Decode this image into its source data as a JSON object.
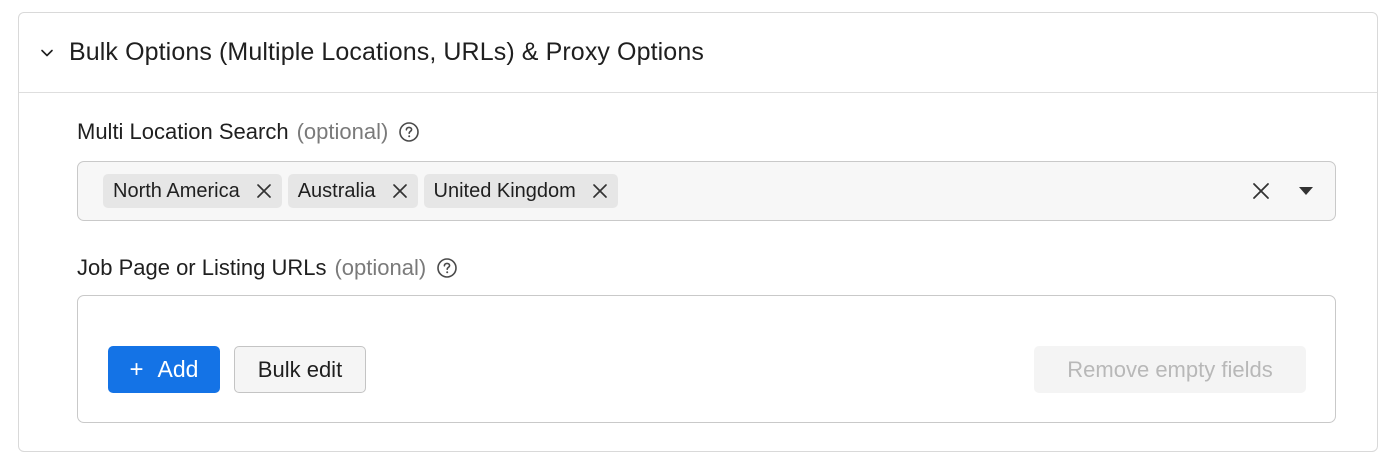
{
  "panel": {
    "title": "Bulk Options (Multiple Locations, URLs) & Proxy Options",
    "icon": "chevron-down-icon"
  },
  "multi_location": {
    "label": "Multi Location Search",
    "optional": "(optional)",
    "chips": [
      {
        "label": "North America"
      },
      {
        "label": "Australia"
      },
      {
        "label": "United Kingdom"
      }
    ]
  },
  "urls": {
    "label": "Job Page or Listing URLs",
    "optional": "(optional)",
    "add_plus": "+",
    "add_label": "Add",
    "bulk_edit_label": "Bulk edit",
    "remove_empty_label": "Remove empty fields"
  },
  "colors": {
    "primary": "#1473e6",
    "border": "#c9c9c9",
    "chip_bg": "#e6e6e6",
    "disabled_text": "#b8b8b8"
  }
}
